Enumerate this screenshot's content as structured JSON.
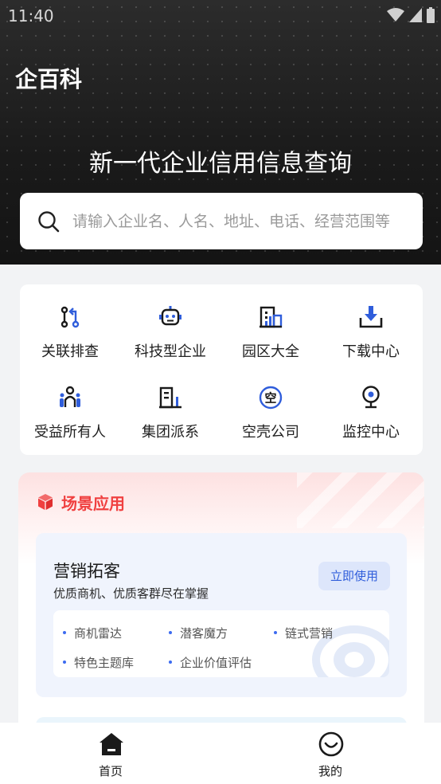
{
  "status_bar": {
    "time": "11:40"
  },
  "header": {
    "logo": "企百科",
    "title": "新一代企业信用信息查询"
  },
  "search": {
    "placeholder": "请输入企业名、人名、地址、电话、经营范围等"
  },
  "quick_tools": [
    {
      "label": "关联排查",
      "icon": "relation-link-icon"
    },
    {
      "label": "科技型企业",
      "icon": "robot-icon"
    },
    {
      "label": "园区大全",
      "icon": "building-icon"
    },
    {
      "label": "下载中心",
      "icon": "download-icon"
    },
    {
      "label": "受益所有人",
      "icon": "people-group-icon"
    },
    {
      "label": "集团派系",
      "icon": "group-building-icon"
    },
    {
      "label": "空壳公司",
      "icon": "empty-shell-icon"
    },
    {
      "label": "监控中心",
      "icon": "monitor-camera-icon"
    }
  ],
  "scene": {
    "title": "场景应用",
    "card": {
      "title": "营销拓客",
      "desc": "优质商机、优质客群尽在掌握",
      "button": "立即使用",
      "features": [
        "商机雷达",
        "潜客魔方",
        "链式营销",
        "特色主题库",
        "企业价值评估"
      ]
    }
  },
  "tabbar": {
    "items": [
      {
        "label": "首页",
        "icon": "home-icon"
      },
      {
        "label": "我的",
        "icon": "smile-face-icon"
      }
    ]
  },
  "colors": {
    "accent_blue": "#2f5ddb",
    "scene_red": "#f04040",
    "hero_bg": "#1c1c1c"
  }
}
